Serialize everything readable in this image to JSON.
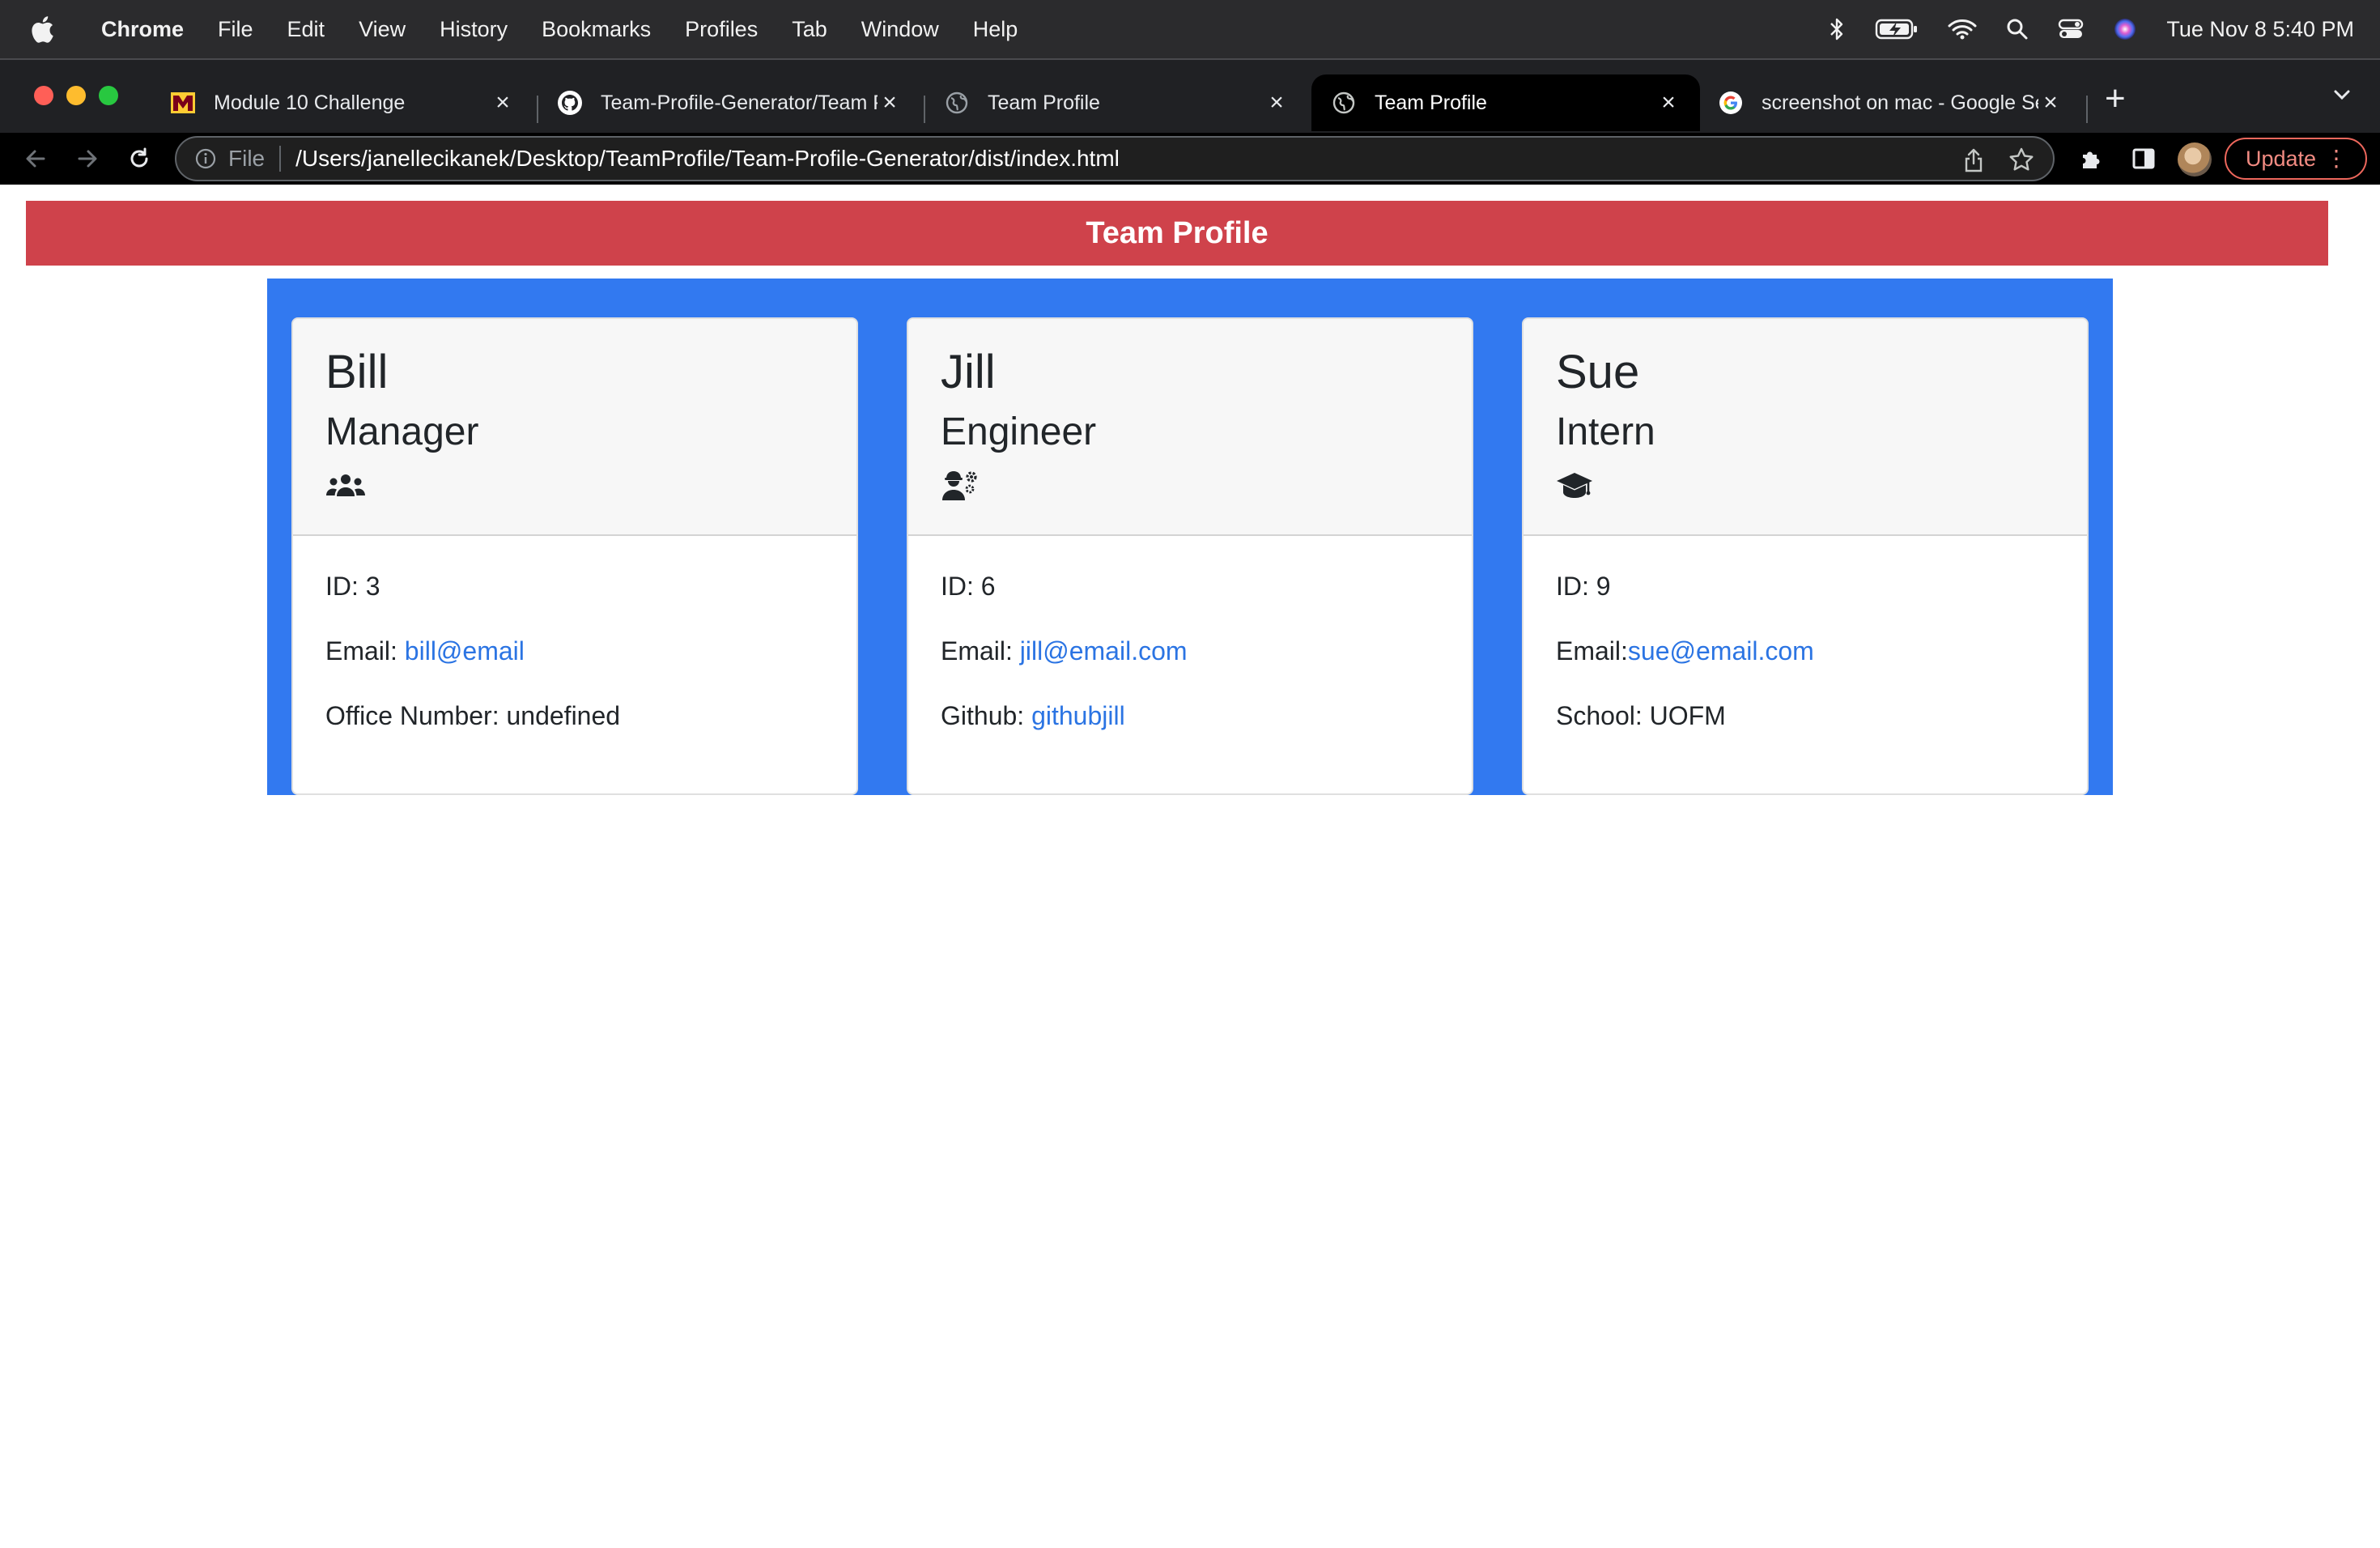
{
  "menubar": {
    "app_name": "Chrome",
    "items": [
      "File",
      "Edit",
      "View",
      "History",
      "Bookmarks",
      "Profiles",
      "Tab",
      "Window",
      "Help"
    ],
    "clock": "Tue Nov 8  5:40 PM"
  },
  "browser": {
    "tabs": [
      {
        "title": "Module 10 Challenge",
        "favicon": "university-m-icon"
      },
      {
        "title": "Team-Profile-Generator/Team P",
        "favicon": "github-icon"
      },
      {
        "title": "Team Profile",
        "favicon": "globe-icon"
      },
      {
        "title": "Team Profile",
        "favicon": "globe-icon",
        "active": true
      },
      {
        "title": "screenshot on mac - Google Se",
        "favicon": "google-icon"
      }
    ],
    "scheme_label": "File",
    "url": "/Users/janellecikanek/Desktop/TeamProfile/Team-Profile-Generator/dist/index.html",
    "update_label": "Update"
  },
  "page": {
    "title": "Team Profile",
    "members": [
      {
        "name": "Bill",
        "role": "Manager",
        "icon": "people-group-icon",
        "id_label": "ID: 3",
        "email_label": "Email: ",
        "email": "bill@email",
        "extra_label": "Office Number: undefined",
        "extra_link": ""
      },
      {
        "name": "Jill",
        "role": "Engineer",
        "icon": "user-gear-icon",
        "id_label": "ID: 6",
        "email_label": "Email: ",
        "email": "jill@email.com",
        "extra_label": "Github: ",
        "extra_link": "githubjill"
      },
      {
        "name": "Sue",
        "role": "Intern",
        "icon": "graduation-cap-icon",
        "id_label": "ID: 9",
        "email_label": "Email:",
        "email": "sue@email.com",
        "extra_label": "School: UOFM",
        "extra_link": ""
      }
    ]
  },
  "colors": {
    "header_red": "#cf424b",
    "container_blue": "#3279f0",
    "link_blue": "#2b74e3"
  }
}
